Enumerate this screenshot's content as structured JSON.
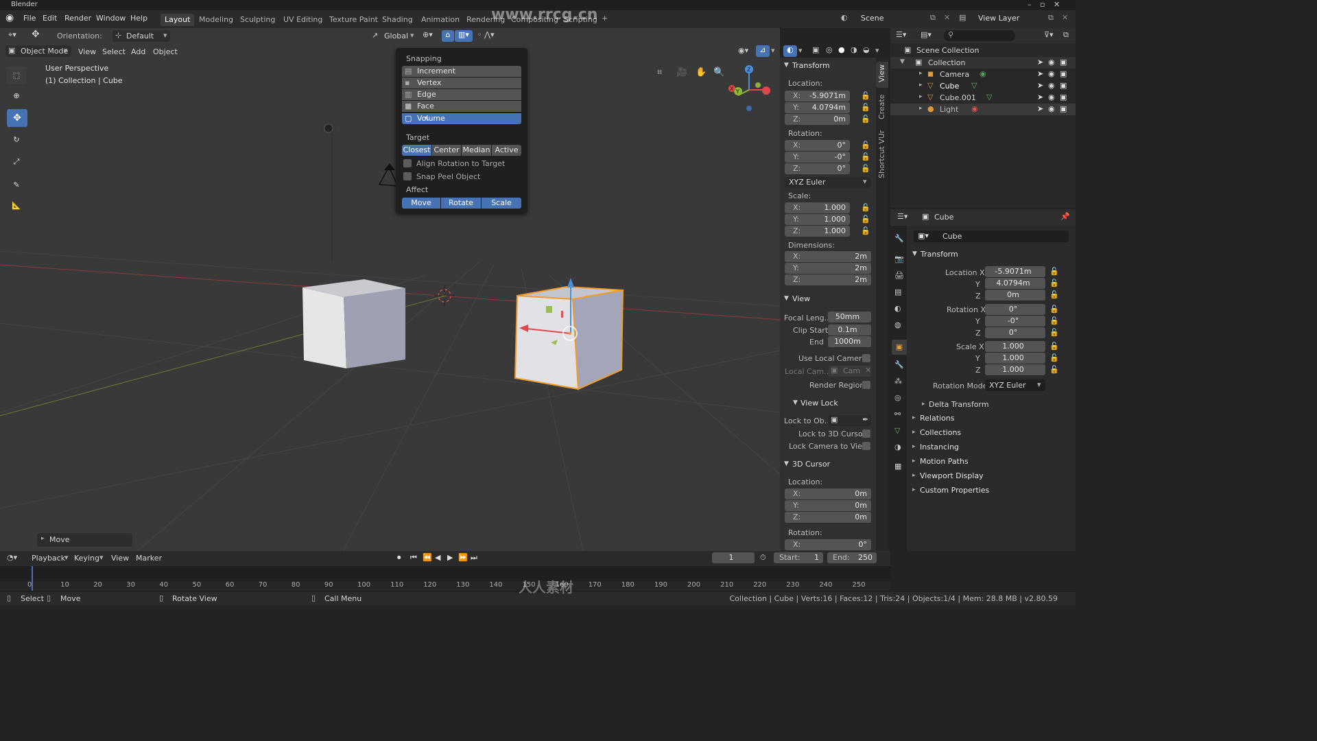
{
  "app": {
    "title": "Blender",
    "watermark": "www.rrcg.cn",
    "watermark_bottom": "人人素材",
    "scene": "Scene",
    "view_layer": "View Layer"
  },
  "menus": [
    "File",
    "Edit",
    "Render",
    "Window",
    "Help"
  ],
  "workspaces": [
    "Layout",
    "Modeling",
    "Sculpting",
    "UV Editing",
    "Texture Paint",
    "Shading",
    "Animation",
    "Rendering",
    "Compositing",
    "Scripting"
  ],
  "header": {
    "orientation_label": "Orientation:",
    "orientation_value": "Default",
    "transform_orientation": "Global",
    "mode": "Object Mode",
    "view": "View",
    "select": "Select",
    "add": "Add",
    "object": "Object"
  },
  "viewport": {
    "perspective": "User Perspective",
    "collection_info": "(1) Collection | Cube",
    "last_op": "Move"
  },
  "snapping": {
    "title": "Snapping",
    "elements": [
      "Increment",
      "Vertex",
      "Edge",
      "Face",
      "Volume"
    ],
    "selected_element": "Volume",
    "target_title": "Target",
    "targets": [
      "Closest",
      "Center",
      "Median",
      "Active"
    ],
    "selected_target": "Closest",
    "align_rotation": "Align Rotation to Target",
    "snap_peel": "Snap Peel Object",
    "affect_title": "Affect",
    "affect": [
      "Move",
      "Rotate",
      "Scale"
    ]
  },
  "npanel": {
    "tabs": [
      "View",
      "Create",
      "Shortcut VUr"
    ],
    "transform": {
      "title": "Transform",
      "location_label": "Location:",
      "location": {
        "x": "-5.9071m",
        "y": "4.0794m",
        "z": "0m"
      },
      "rotation_label": "Rotation:",
      "rotation": {
        "x": "0°",
        "y": "-0°",
        "z": "0°"
      },
      "rotation_mode": "XYZ Euler",
      "scale_label": "Scale:",
      "scale": {
        "x": "1.000",
        "y": "1.000",
        "z": "1.000"
      },
      "dimensions_label": "Dimensions:",
      "dimensions": {
        "x": "2m",
        "y": "2m",
        "z": "2m"
      }
    },
    "view": {
      "title": "View",
      "focal_label": "Focal Leng..",
      "focal": "50mm",
      "clip_start_label": "Clip Start",
      "clip_start": "0.1m",
      "clip_end_label": "End",
      "clip_end": "1000m",
      "use_local_camera": "Use Local Camera",
      "local_cam_label": "Local Cam...",
      "local_cam_value": "Cam",
      "render_region": "Render Region",
      "view_lock": "View Lock",
      "lock_to_obj": "Lock to Ob..",
      "lock_cursor": "Lock to 3D Cursor",
      "lock_camera": "Lock Camera to View"
    },
    "cursor": {
      "title": "3D Cursor",
      "location_label": "Location:",
      "location": {
        "x": "0m",
        "y": "0m",
        "z": "0m"
      },
      "rotation_label": "Rotation:",
      "rotation_x": "0°"
    },
    "axis": {
      "x": "X:",
      "y": "Y:",
      "z": "Z:"
    }
  },
  "outliner": {
    "scene_collection": "Scene Collection",
    "items": [
      {
        "name": "Collection",
        "indent": 0
      },
      {
        "name": "Camera",
        "indent": 1
      },
      {
        "name": "Cube",
        "indent": 1
      },
      {
        "name": "Cube.001",
        "indent": 1
      },
      {
        "name": "Light",
        "indent": 1
      }
    ]
  },
  "properties": {
    "object": "Cube",
    "object_name": "Cube",
    "transform_title": "Transform",
    "location_x_label": "Location X",
    "y_label": "Y",
    "z_label": "Z",
    "rotation_x_label": "Rotation X",
    "scale_x_label": "Scale X",
    "location": [
      "-5.9071m",
      "4.0794m",
      "0m"
    ],
    "rotation": [
      "0°",
      "-0°",
      "0°"
    ],
    "scale": [
      "1.000",
      "1.000",
      "1.000"
    ],
    "rotation_mode_label": "Rotation Mode",
    "rotation_mode": "XYZ Euler",
    "delta": "Delta Transform",
    "sections": [
      "Relations",
      "Collections",
      "Instancing",
      "Motion Paths",
      "Viewport Display",
      "Custom Properties"
    ]
  },
  "timeline": {
    "playback": "Playback",
    "keying": "Keying",
    "view": "View",
    "marker": "Marker",
    "current_frame": "1",
    "start_label": "Start:",
    "start": "1",
    "end_label": "End:",
    "end": "250",
    "ticks": [
      "0",
      "10",
      "20",
      "30",
      "40",
      "50",
      "60",
      "70",
      "80",
      "90",
      "100",
      "110",
      "120",
      "130",
      "140",
      "150",
      "160",
      "170",
      "180",
      "190",
      "200",
      "210",
      "220",
      "230",
      "240",
      "250"
    ]
  },
  "statusbar": {
    "select": "Select",
    "move": "Move",
    "rotate_view": "Rotate View",
    "call_menu": "Call Menu",
    "stats": "Collection | Cube | Verts:16 | Faces:12 | Tris:24 | Objects:1/4 | Mem: 28.8 MB | v2.80.59"
  },
  "colors": {
    "accent": "#4772b3",
    "selection": "#f29c2b",
    "bg": "#393939"
  }
}
